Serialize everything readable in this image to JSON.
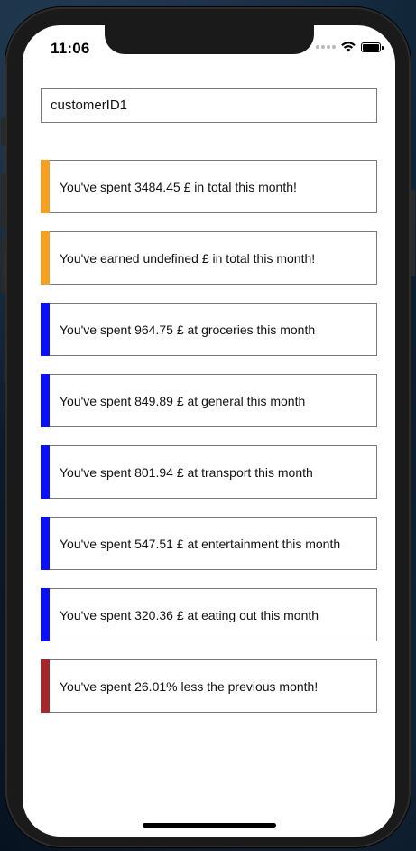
{
  "status_bar": {
    "time": "11:06"
  },
  "customer_input": {
    "value": "customerID1"
  },
  "colors": {
    "orange": "#f5a023",
    "blue": "#0a12f5",
    "red": "#a3282c"
  },
  "cards": [
    {
      "text": "You've spent 3484.45 £ in total this month!",
      "accent": "orange"
    },
    {
      "text": "You've earned undefined £ in total this month!",
      "accent": "orange"
    },
    {
      "text": "You've spent 964.75 £ at groceries this month",
      "accent": "blue"
    },
    {
      "text": "You've spent 849.89 £ at general this month",
      "accent": "blue"
    },
    {
      "text": "You've spent 801.94 £ at transport this month",
      "accent": "blue"
    },
    {
      "text": "You've spent 547.51 £ at entertainment this month",
      "accent": "blue"
    },
    {
      "text": "You've spent 320.36 £ at eating out this month",
      "accent": "blue"
    },
    {
      "text": "You've spent 26.01% less the previous month!",
      "accent": "red"
    }
  ]
}
